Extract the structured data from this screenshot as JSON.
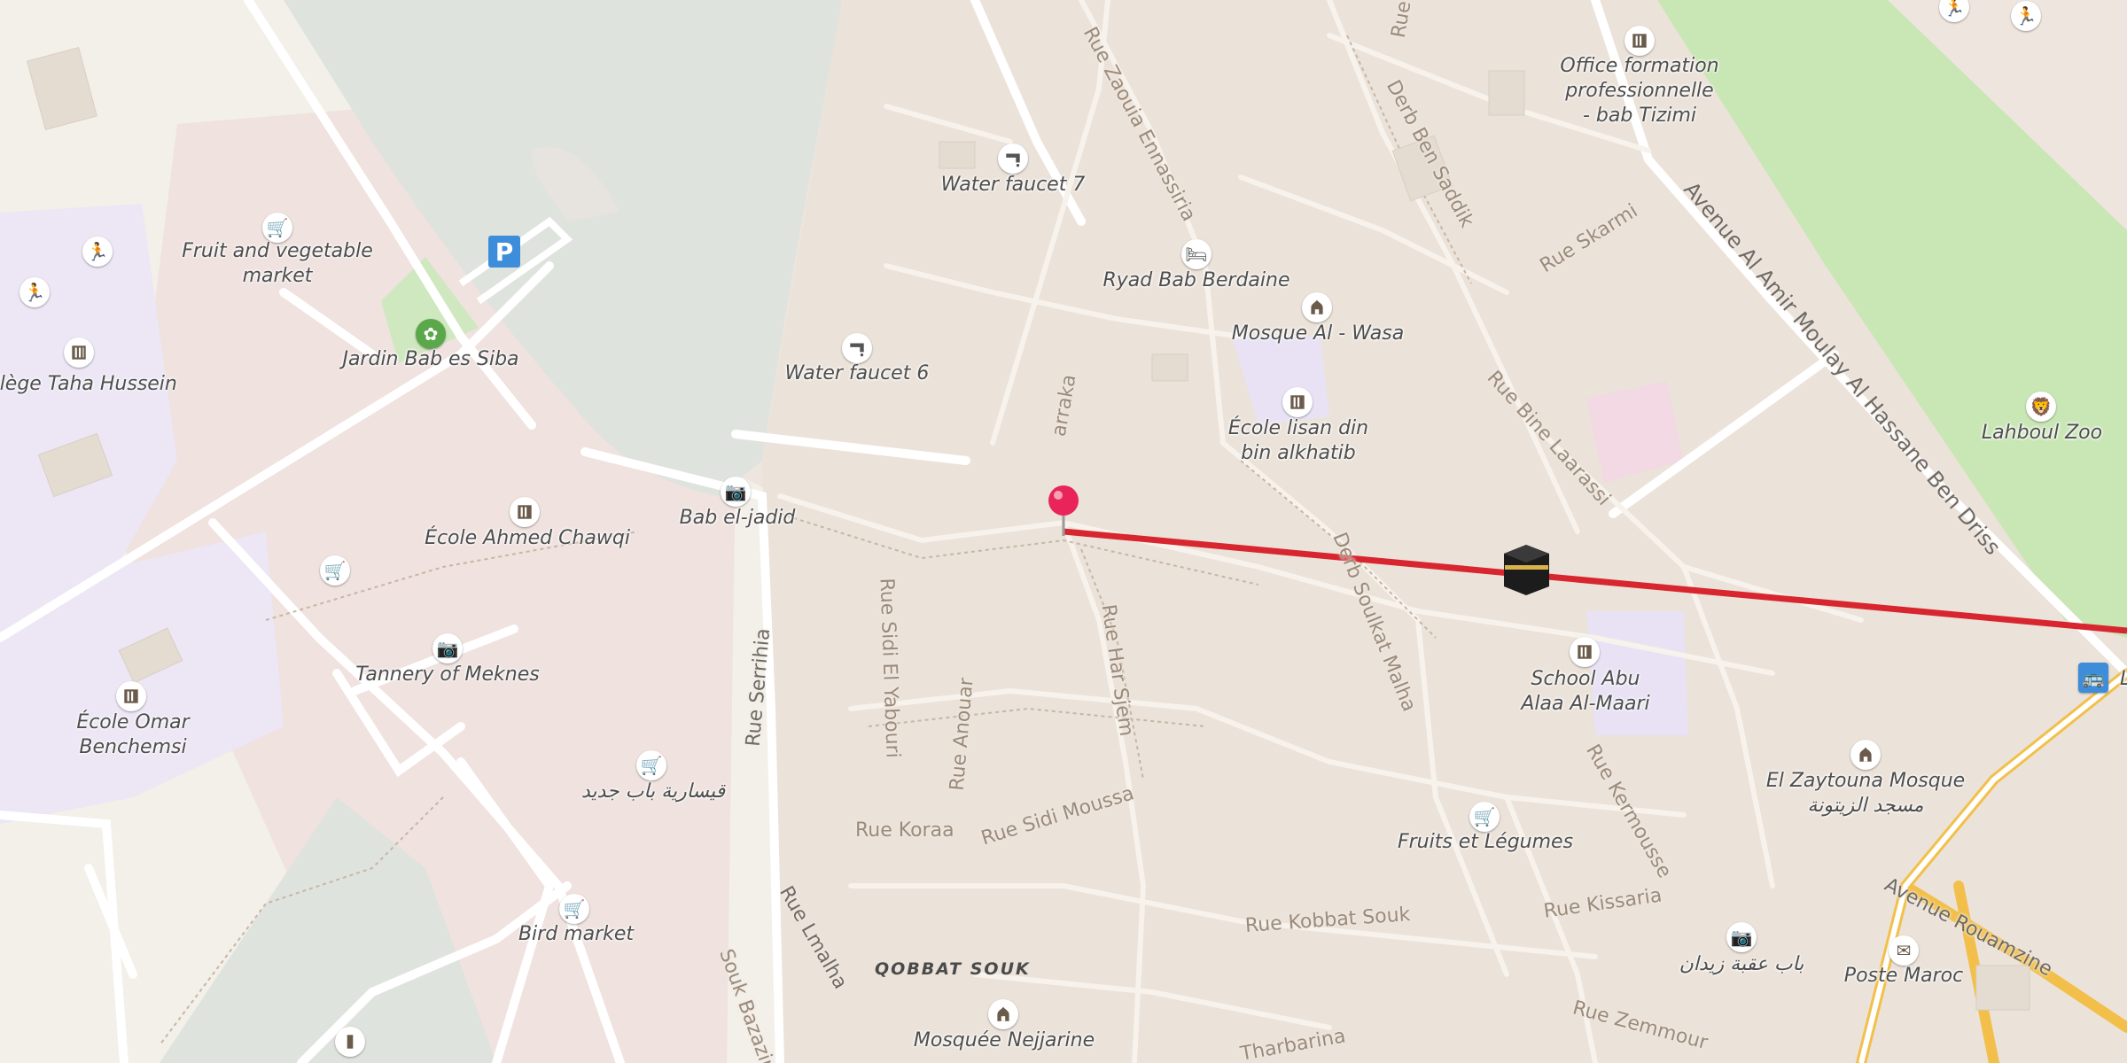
{
  "colors": {
    "route": "#d7262f",
    "pin": "#e8245a",
    "building_area": "#ece4dc",
    "water": "#dde2dc",
    "park": "#c9e6b5",
    "school": "#efeafb",
    "main_road": "#f5c548"
  },
  "pois": [
    {
      "id": "fruit-veg-market",
      "name": "Fruit and vegetable market",
      "icon": "cart-icon"
    },
    {
      "id": "college-taha",
      "name": "ollège Taha Hussein",
      "icon": "school-icon"
    },
    {
      "id": "jardin-bab",
      "name": "Jardin Bab es Siba",
      "icon": "garden-icon"
    },
    {
      "id": "water-faucet-7",
      "name": "Water faucet 7",
      "icon": "faucet-icon"
    },
    {
      "id": "water-faucet-6",
      "name": "Water faucet 6",
      "icon": "faucet-icon"
    },
    {
      "id": "ryad",
      "name": "Ryad Bab Berdaine",
      "icon": "bed-icon"
    },
    {
      "id": "mosque-wasa",
      "name": "Mosque Al - Wasa",
      "icon": "mosque-icon"
    },
    {
      "id": "ecole-lisan",
      "name": "École lisan din bin alkhatib",
      "icon": "school-icon"
    },
    {
      "id": "office-formation",
      "name": "Office formation professionnelle - bab Tizimi",
      "icon": "school-icon"
    },
    {
      "id": "lahboul",
      "name": "Lahboul Zoo",
      "icon": "zoo-icon"
    },
    {
      "id": "bab-jadid",
      "name": "Bab el-jadid",
      "icon": "camera-icon"
    },
    {
      "id": "ecole-chawqi",
      "name": "École Ahmed Chawqi",
      "icon": "school-icon"
    },
    {
      "id": "tannery",
      "name": "Tannery of Meknes",
      "icon": "camera-icon"
    },
    {
      "id": "ecole-omar",
      "name": "École Omar Benchemsi",
      "icon": "school-icon"
    },
    {
      "id": "qissaria",
      "name": "قيسارية باب جديد",
      "icon": "cart-icon"
    },
    {
      "id": "bird-market",
      "name": "Bird market",
      "icon": "cart-icon"
    },
    {
      "id": "school-abu",
      "name": "School Abu Alaa Al-Maari",
      "icon": "school-icon"
    },
    {
      "id": "zaytouna",
      "name": "El Zaytouna Mosque\nمسجد الزيتونة",
      "icon": "mosque-icon"
    },
    {
      "id": "fruits-legumes",
      "name": "Fruits et Légumes",
      "icon": "cart-icon"
    },
    {
      "id": "bab-aqba",
      "name": "باب عقبة زيدان",
      "icon": "camera-icon"
    },
    {
      "id": "poste",
      "name": "Poste Maroc",
      "icon": "mail-icon"
    },
    {
      "id": "nejjarine",
      "name": "Mosquée Nejjarine",
      "icon": "mosque-icon"
    }
  ],
  "streets": {
    "zaouia": "Rue Zaouia Ennassiria",
    "ben_saddik": "Derb Ben Saddik",
    "skarmi": "Rue Skarmi",
    "moulay": "Avenue Al Amir Moulay Al Hassane Ben Driss",
    "bine_laarassi": "Rue Bine Laarassi",
    "soulkat": "Derb Soulkat Malha",
    "sidi_yabouri": "Rue Sidi El Yabouri",
    "anouar": "Rue Anouar",
    "har_sjem": "Rue Har Sjem",
    "serrihia": "Rue Serrihia",
    "koraa": "Rue Koraa",
    "sidi_moussa": "Rue Sidi Moussa",
    "lmalha": "Rue Lmalha",
    "kermousse": "Rue Kermousse",
    "kissaria": "Rue Kissaria",
    "kobbat": "Rue Kobbat Souk",
    "rouamzine": "Avenue Rouamzine",
    "zemmour": "Rue Zemmour",
    "bazazine": "Souk Bazazine",
    "tharbarina": "Tharbarina",
    "tarraka": "arraka",
    "rue_top": "Rue"
  },
  "district": "QOBBAT SOUK",
  "parking_label": "P",
  "edge_label": "L"
}
